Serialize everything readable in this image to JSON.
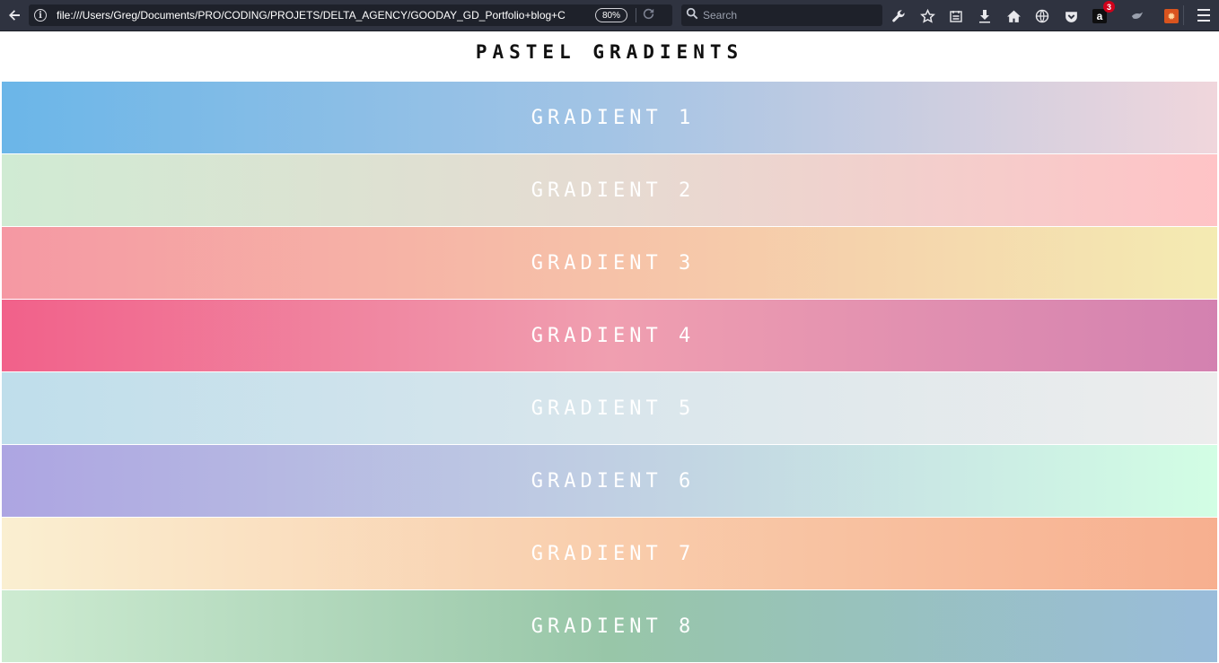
{
  "browser": {
    "url": "file:///Users/Greg/Documents/PRO/CODING/PROJETS/DELTA_AGENCY/GOODAY_GD_Portfolio+blog+C",
    "zoom": "80%",
    "search_placeholder": "Search",
    "notification_count": "3",
    "amazon_letter": "a",
    "icons": [
      "back-arrow-icon",
      "info-icon",
      "reload-icon",
      "search-icon",
      "wrench-icon",
      "star-icon",
      "reader-icon",
      "download-icon",
      "home-icon",
      "globe-icon",
      "pocket-icon",
      "amazon-icon",
      "bird-icon",
      "extension-icon",
      "hamburger-menu-icon"
    ]
  },
  "page": {
    "title": "PASTEL GRADIENTS"
  },
  "gradients": [
    {
      "label": "GRADIENT 1",
      "from": "#6bb6e8",
      "mid": "#a3c4e5",
      "to": "#f0d6dc"
    },
    {
      "label": "GRADIENT 2",
      "from": "#d0ebd3",
      "mid": "#e6dbd2",
      "to": "#ffc3c6"
    },
    {
      "label": "GRADIENT 3",
      "from": "#f598a3",
      "mid": "#f6c2a8",
      "to": "#f4ebb2"
    },
    {
      "label": "GRADIENT 4",
      "from": "#f1618a",
      "mid": "#f09fb0",
      "to": "#d381b0"
    },
    {
      "label": "GRADIENT 5",
      "from": "#bfdeeb",
      "mid": "#d9e6ec",
      "to": "#ededed"
    },
    {
      "label": "GRADIENT 6",
      "from": "#ada5e2",
      "mid": "#c0cfe3",
      "to": "#d2fee4"
    },
    {
      "label": "GRADIENT 7",
      "from": "#faefd1",
      "mid": "#f9cdac",
      "to": "#f7af8f"
    },
    {
      "label": "GRADIENT 8",
      "from": "#cdebd1",
      "mid": "#98c6a8",
      "to": "#99bcda"
    }
  ]
}
